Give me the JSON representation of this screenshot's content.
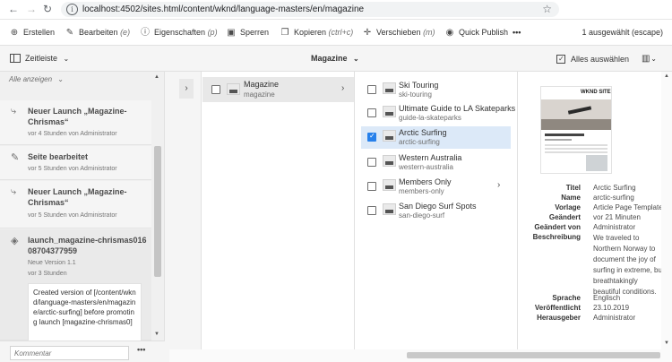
{
  "browser": {
    "url": "localhost:4502/sites.html/content/wknd/language-masters/en/magazine"
  },
  "actions": [
    {
      "label": "Erstellen",
      "shortcut": "",
      "icon": "plus-circle-icon"
    },
    {
      "label": "Bearbeiten",
      "shortcut": "(e)",
      "icon": "pencil-icon"
    },
    {
      "label": "Eigenschaften",
      "shortcut": "(p)",
      "icon": "info-icon"
    },
    {
      "label": "Sperren",
      "shortcut": "",
      "icon": "lock-icon"
    },
    {
      "label": "Kopieren",
      "shortcut": "(ctrl+c)",
      "icon": "copy-icon"
    },
    {
      "label": "Verschieben",
      "shortcut": "(m)",
      "icon": "move-icon"
    },
    {
      "label": "Quick Publish",
      "shortcut": "",
      "icon": "globe-icon"
    }
  ],
  "more_label": "•••",
  "selection_status": "1 ausgewählt (escape)",
  "toolbar": {
    "rail_label": "Zeitleiste",
    "title": "Magazine",
    "select_all": "Alles auswählen"
  },
  "timeline": {
    "filter": "Alle anzeigen",
    "items": [
      {
        "title": "Neuer Launch „Magazine-Chrismas“",
        "meta": "vor 4 Stunden von Administrator"
      },
      {
        "title": "Seite bearbeitet",
        "meta": "vor 5 Stunden von Administrator"
      },
      {
        "title": "Neuer Launch „Magazine-Chrismas“",
        "meta": "vor 5 Stunden von Administrator"
      },
      {
        "title": "launch_magazine-chrismas01608704377959",
        "version": "Neue Version 1.1",
        "meta": "vor 3 Stunden",
        "comment": "Created version of [/content/wknd/language-masters/en/magazine/arctic-surfing] before promoting launch [magazine-chrismas0]"
      }
    ],
    "comment_placeholder": "Kommentar"
  },
  "column1": {
    "title": "Magazine",
    "name": "magazine"
  },
  "column2": [
    {
      "title": "Ski Touring",
      "name": "ski-touring",
      "checked": false,
      "has_children": false
    },
    {
      "title": "Ultimate Guide to LA Skateparks",
      "name": "guide-la-skateparks",
      "checked": false,
      "has_children": false
    },
    {
      "title": "Arctic Surfing",
      "name": "arctic-surfing",
      "checked": true,
      "has_children": false
    },
    {
      "title": "Western Australia",
      "name": "western-australia",
      "checked": false,
      "has_children": false
    },
    {
      "title": "Members Only",
      "name": "members-only",
      "checked": false,
      "has_children": true
    },
    {
      "title": "San Diego Surf Spots",
      "name": "san-diego-surf",
      "checked": false,
      "has_children": false
    }
  ],
  "preview": {
    "brand": "WKND SITE",
    "meta": [
      {
        "k": "Titel",
        "v": "Arctic Surfing"
      },
      {
        "k": "Name",
        "v": "arctic-surfing"
      },
      {
        "k": "Vorlage",
        "v": "Article Page Template"
      },
      {
        "k": "Geändert",
        "v": "vor 21 Minuten"
      },
      {
        "k": "Geändert von",
        "v": "Administrator"
      },
      {
        "k": "Beschreibung",
        "v": "We traveled to Northern Norway to document the joy of surfing in extreme, but breathtakingly beautiful conditions."
      },
      {
        "k": "Sprache",
        "v": "Englisch"
      },
      {
        "k": "Veröffentlicht",
        "v": "23.10.2019"
      },
      {
        "k": "Herausgeber",
        "v": "Administrator"
      }
    ]
  }
}
